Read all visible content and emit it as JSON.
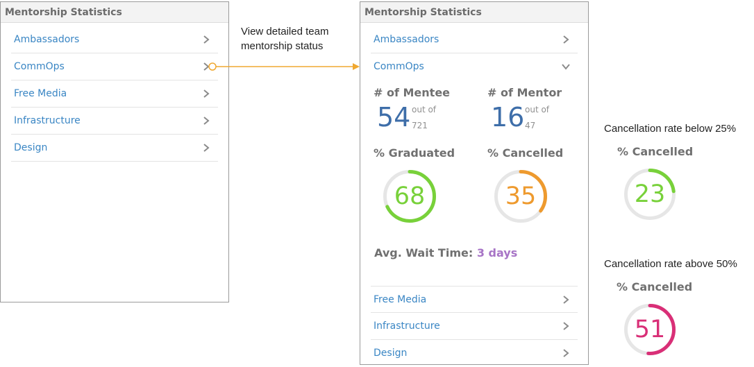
{
  "left_panel": {
    "title": "Mentorship Statistics",
    "items": [
      {
        "label": "Ambassadors"
      },
      {
        "label": "CommOps"
      },
      {
        "label": "Free Media"
      },
      {
        "label": "Infrastructure"
      },
      {
        "label": "Design"
      }
    ]
  },
  "annotation": {
    "line1": "View detailed team",
    "line2": "mentorship status",
    "color": "#f0a830"
  },
  "right_panel": {
    "title": "Mentorship Statistics",
    "items_top": [
      {
        "label": "Ambassadors"
      },
      {
        "label": "CommOps"
      }
    ],
    "expanded": {
      "mentee": {
        "label": "# of Mentee",
        "value": "54",
        "out_of_label": "out of",
        "out_of_value": "721"
      },
      "mentor": {
        "label": "# of Mentor",
        "value": "16",
        "out_of_label": "out of",
        "out_of_value": "47"
      },
      "graduated": {
        "label": "% Graduated",
        "value": "68",
        "percent": 68,
        "color": "#78d13a"
      },
      "cancelled": {
        "label": "% Cancelled",
        "value": "35",
        "percent": 35,
        "color": "#ee9a2e"
      },
      "wait": {
        "label": "Avg. Wait Time:",
        "value": "3 days"
      }
    },
    "items_bottom": [
      {
        "label": "Free Media"
      },
      {
        "label": "Infrastructure"
      },
      {
        "label": "Design"
      }
    ]
  },
  "examples": {
    "low": {
      "caption": "Cancellation rate below 25%",
      "label": "% Cancelled",
      "value": "23",
      "percent": 23,
      "color": "#78d13a"
    },
    "high": {
      "caption": "Cancellation rate above 50%",
      "label": "% Cancelled",
      "value": "51",
      "percent": 51,
      "color": "#d92f77"
    }
  },
  "colors": {
    "link": "#3a86c4",
    "track": "#e6e6e6",
    "number": "#3e6ea9",
    "wait_value": "#a774c6"
  }
}
